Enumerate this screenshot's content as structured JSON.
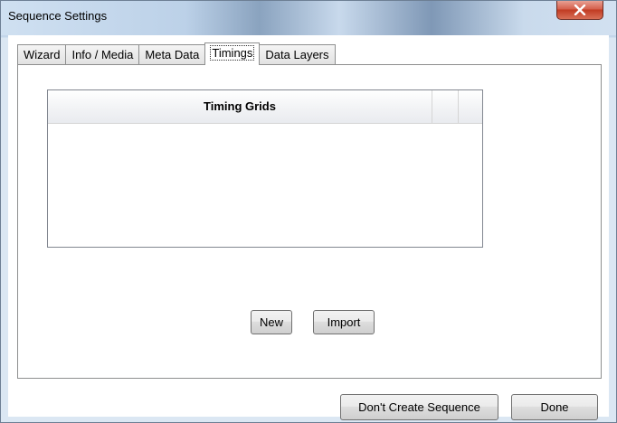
{
  "window": {
    "title": "Sequence Settings"
  },
  "tabs": [
    {
      "label": "Wizard",
      "active": false
    },
    {
      "label": "Info / Media",
      "active": false
    },
    {
      "label": "Meta Data",
      "active": false
    },
    {
      "label": "Timings",
      "active": true
    },
    {
      "label": "Data Layers",
      "active": false
    }
  ],
  "timings": {
    "grid": {
      "columns": [
        "Timing Grids",
        "",
        ""
      ],
      "rows": []
    },
    "new_label": "New",
    "import_label": "Import"
  },
  "footer": {
    "dont_create_label": "Don't Create Sequence",
    "done_label": "Done"
  },
  "icons": {
    "close": "close-icon"
  },
  "colors": {
    "close_button": "#c9432a",
    "titlebar": "#c3d6ea"
  }
}
